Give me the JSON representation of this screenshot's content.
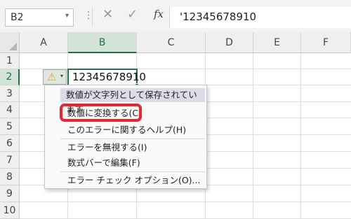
{
  "formula_bar": {
    "name_box": "B2",
    "name_box_arrow": "▾",
    "dots": "⋮",
    "cancel_icon": "✕",
    "enter_icon": "✓",
    "fx_label": "fx",
    "formula_value": "'12345678910"
  },
  "grid": {
    "columns": [
      "A",
      "B",
      "C",
      "D",
      "E",
      "F"
    ],
    "rows": [
      "1",
      "2",
      "3",
      "4",
      "5",
      "6",
      "7",
      "8",
      "9",
      "10"
    ],
    "active_column": "B",
    "active_row": "2",
    "active_cell_value": "12345678910"
  },
  "smart_tag": {
    "warning_icon": "⚠",
    "dropdown_icon": "▾"
  },
  "menu": {
    "header": "数値が文字列として保存されています",
    "items": [
      "数値に変換する(C)",
      "このエラーに関するヘルプ(H)",
      "エラーを無視する(I)",
      "数式バーで編集(F)",
      "エラー チェック オプション(O)..."
    ],
    "highlight_color": "#e8262b"
  },
  "colors": {
    "accent_green": "#217346",
    "warning_yellow": "#e8a317"
  }
}
